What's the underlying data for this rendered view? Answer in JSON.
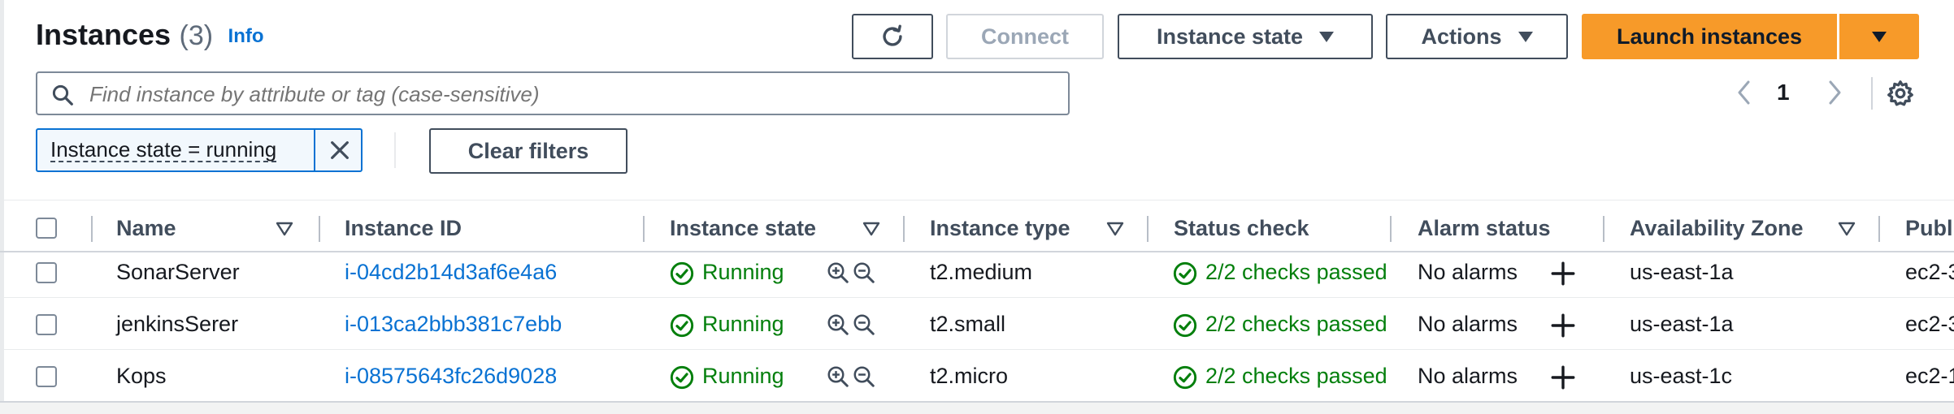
{
  "header": {
    "title": "Instances",
    "count": "(3)",
    "info_link": "Info",
    "connect_label": "Connect",
    "instance_state_label": "Instance state",
    "actions_label": "Actions",
    "launch_label": "Launch instances"
  },
  "search": {
    "placeholder": "Find instance by attribute or tag (case-sensitive)"
  },
  "pagination": {
    "page": "1"
  },
  "filters": {
    "token": "Instance state = running",
    "clear_label": "Clear filters"
  },
  "table": {
    "columns": [
      "Name",
      "Instance ID",
      "Instance state",
      "Instance type",
      "Status check",
      "Alarm status",
      "Availability Zone",
      "Publi"
    ],
    "rows": [
      {
        "name": "SonarServer",
        "id": "i-04cd2b14d3af6e4a6",
        "state": "Running",
        "type": "t2.medium",
        "status": "2/2 checks passed",
        "alarm": "No alarms",
        "az": "us-east-1a",
        "public": "ec2-3"
      },
      {
        "name": "jenkinsSerer",
        "id": "i-013ca2bbb381c7ebb",
        "state": "Running",
        "type": "t2.small",
        "status": "2/2 checks passed",
        "alarm": "No alarms",
        "az": "us-east-1a",
        "public": "ec2-3"
      },
      {
        "name": "Kops",
        "id": "i-08575643fc26d9028",
        "state": "Running",
        "type": "t2.micro",
        "status": "2/2 checks passed",
        "alarm": "No alarms",
        "az": "us-east-1c",
        "public": "ec2-1"
      }
    ]
  },
  "colors": {
    "primary": "#f79a29",
    "link": "#0972d3",
    "success": "#037f0c",
    "text": "#16191f"
  }
}
